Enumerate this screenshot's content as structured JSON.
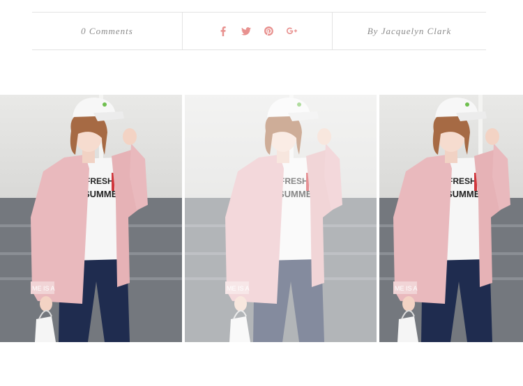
{
  "post_meta": {
    "comments_label": "0 Comments",
    "author_label": "By Jacquelyn Clark"
  },
  "share": {
    "accent_color": "#e8918f",
    "icons": [
      "facebook-icon",
      "twitter-icon",
      "pinterest-icon",
      "google-plus-icon"
    ]
  },
  "gallery": {
    "images": [
      {
        "name": "gallery-photo-1",
        "state": "normal"
      },
      {
        "name": "gallery-photo-2",
        "state": "dimmed"
      },
      {
        "name": "gallery-photo-3",
        "state": "normal"
      }
    ],
    "shirt_print": {
      "line1": "FRESH",
      "line2": "SUMMER",
      "cuff": "ME IS A"
    }
  },
  "colors": {
    "border": "#e3e3e3",
    "meta_text": "#8a8a8a",
    "shirt_pink": "#e9b9bd",
    "jeans_blue": "#1f2c4f",
    "wall_light": "#e4e4e2",
    "wall_dark": "#74787e"
  }
}
